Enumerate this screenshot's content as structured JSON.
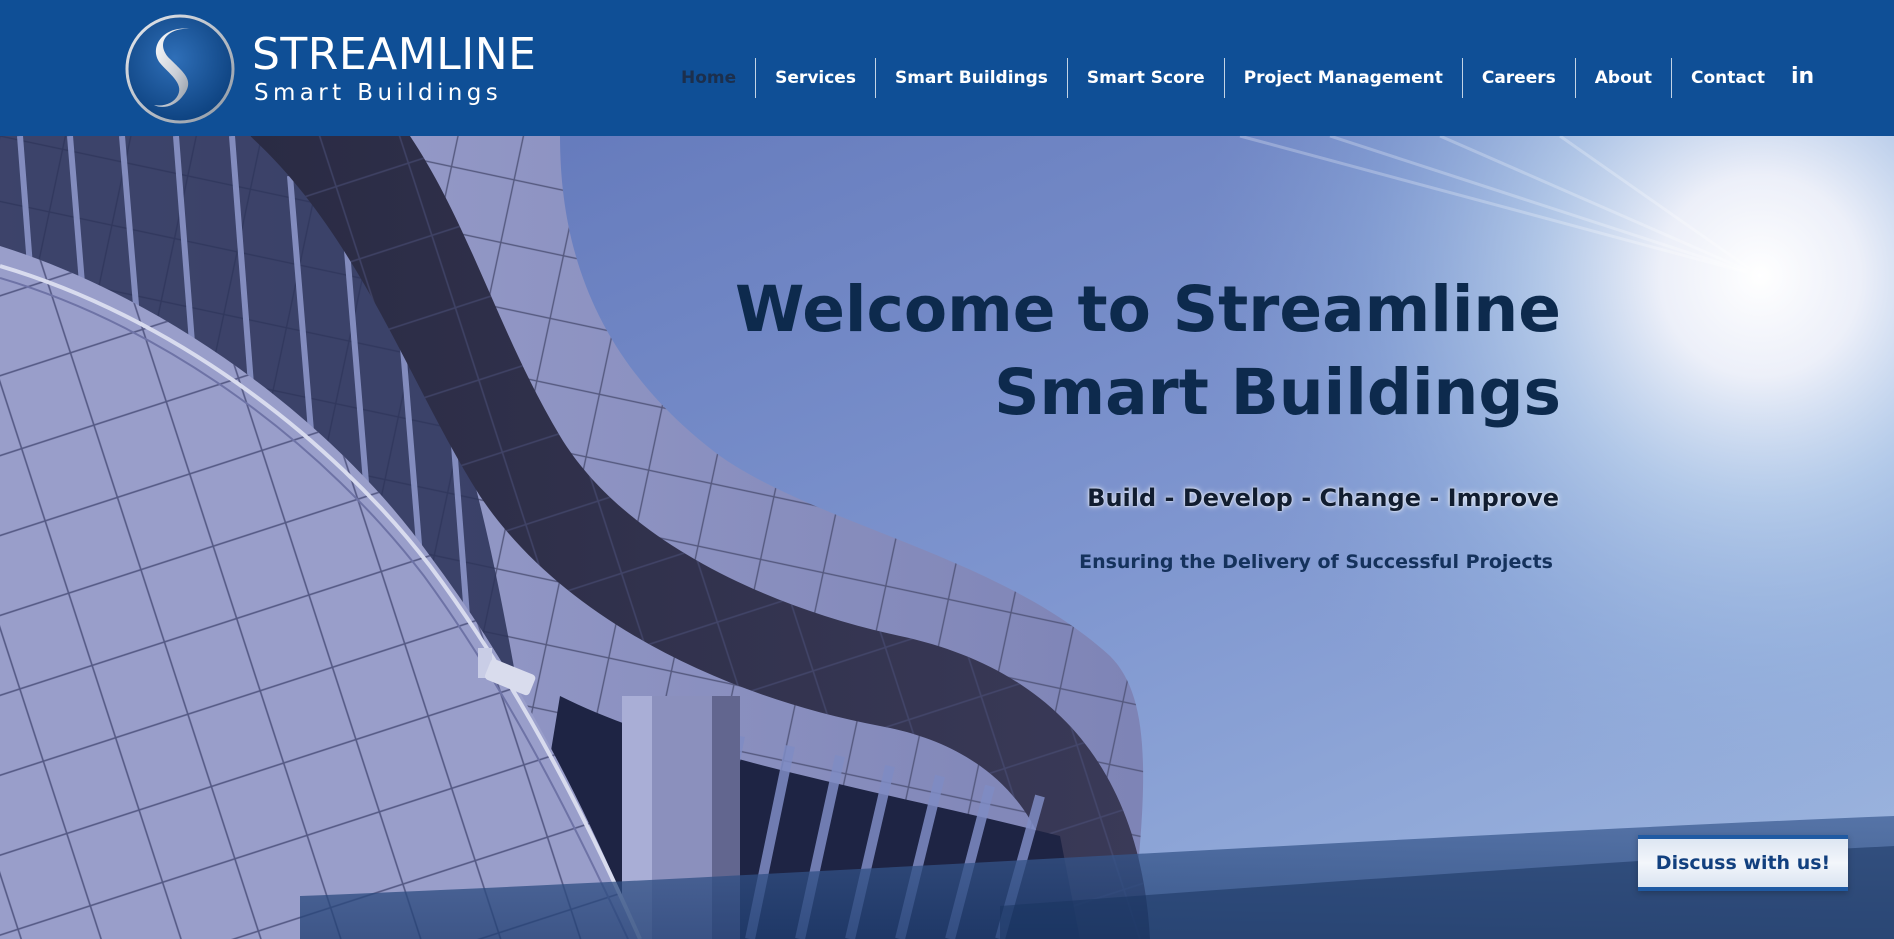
{
  "brand": {
    "name": "STREAMLINE",
    "subtitle": "Smart Buildings",
    "logo_icon": "streamline-s-logo"
  },
  "nav": {
    "items": [
      {
        "label": "Home",
        "active": true
      },
      {
        "label": "Services"
      },
      {
        "label": "Smart Buildings"
      },
      {
        "label": "Smart Score"
      },
      {
        "label": "Project Management"
      },
      {
        "label": "Careers"
      },
      {
        "label": "About"
      },
      {
        "label": "Contact"
      }
    ],
    "linkedin_label": "in",
    "linkedin_icon": "linkedin-icon"
  },
  "hero": {
    "title_line1": "Welcome to Streamline",
    "title_line2": "Smart Buildings",
    "tagline": "Build - Develop - Change - Improve",
    "subline": "Ensuring the Delivery of Successful Projects",
    "cta_label": "Discuss with us!"
  },
  "colors": {
    "header_bg": "#0f4f96",
    "title_text": "#0d2a4d",
    "active_nav": "#1c2f4c",
    "cta_border": "#1f5aa3"
  }
}
